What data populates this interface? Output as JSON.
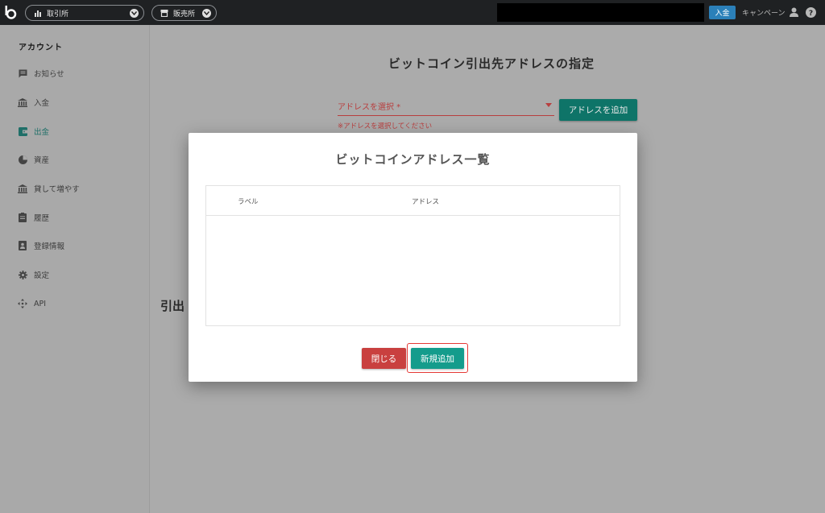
{
  "topbar": {
    "trade_label": "取引所",
    "shop_label": "販売所",
    "deposit_label": "入金",
    "campaign_label": "キャンペーン"
  },
  "sidebar": {
    "title": "アカウント",
    "items": [
      {
        "label": "お知らせ",
        "icon": "message-icon"
      },
      {
        "label": "入金",
        "icon": "bank-icon"
      },
      {
        "label": "出金",
        "icon": "wallet-icon",
        "active": true
      },
      {
        "label": "資産",
        "icon": "pie-chart-icon"
      },
      {
        "label": "貸して増やす",
        "icon": "bank-icon"
      },
      {
        "label": "履歴",
        "icon": "clipboard-icon"
      },
      {
        "label": "登録情報",
        "icon": "id-card-icon"
      },
      {
        "label": "設定",
        "icon": "gear-icon"
      },
      {
        "label": "API",
        "icon": "api-icon"
      }
    ]
  },
  "main": {
    "title": "ビットコイン引出先アドレスの指定",
    "address_select_placeholder": "アドレスを選択 *",
    "address_error": "※アドレスを選択してください",
    "add_address_label": "アドレスを追加",
    "partial_heading": "引出"
  },
  "modal": {
    "title": "ビットコインアドレス一覧",
    "columns": [
      "ラベル",
      "アドレス"
    ],
    "rows": [],
    "close_label": "閉じる",
    "new_label": "新規追加"
  },
  "colors": {
    "accent_teal": "#149c8c",
    "danger_red": "#c9403f",
    "deposit_blue": "#2b80b9"
  }
}
